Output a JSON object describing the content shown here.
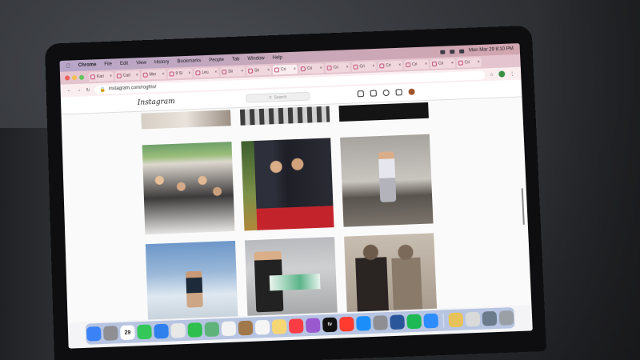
{
  "menubar": {
    "app_name": "Chrome",
    "menus": [
      "File",
      "Edit",
      "View",
      "History",
      "Bookmarks",
      "People",
      "Tab",
      "Window",
      "Help"
    ],
    "clock": "Mon Mar 29  8:10 PM"
  },
  "tabs": [
    {
      "label": "Kari"
    },
    {
      "label": "Carl"
    },
    {
      "label": "Mer"
    },
    {
      "label": "9 Si"
    },
    {
      "label": "Leu"
    },
    {
      "label": "Sir"
    },
    {
      "label": "Sir"
    },
    {
      "label": "Cri",
      "active": true
    },
    {
      "label": "Cri"
    },
    {
      "label": "Cri"
    },
    {
      "label": "Cri"
    },
    {
      "label": "Cri"
    },
    {
      "label": "Cri"
    },
    {
      "label": "Cri"
    },
    {
      "label": "Cri"
    },
    {
      "label": "Cri"
    }
  ],
  "address_bar": {
    "url": "instagram.com/rogfrio/"
  },
  "instagram": {
    "logo": "Instagram",
    "search_placeholder": "Search"
  },
  "dock": {
    "calendar_day": "29",
    "tv_label": "tv"
  },
  "colors": {
    "menubar": "#c8a8b9",
    "tab_strip": "#e3c4cf",
    "dock": "#466ebe"
  }
}
